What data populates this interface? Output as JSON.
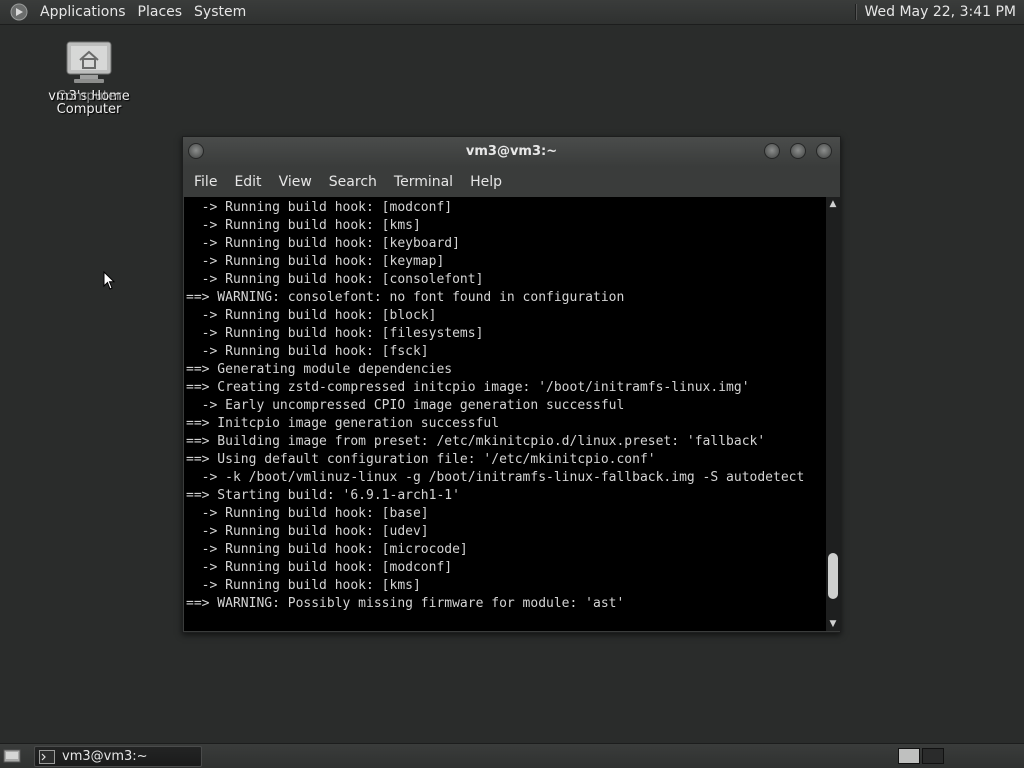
{
  "top_panel": {
    "menu": [
      "Applications",
      "Places",
      "System"
    ],
    "clock": "Wed May 22,  3:41 PM"
  },
  "desktop_icon": {
    "label_overlap_a": "vm3's Home",
    "label_overlap_b": "Computer",
    "label_line2": "Computer"
  },
  "window": {
    "title": "vm3@vm3:~",
    "menu": [
      "File",
      "Edit",
      "View",
      "Search",
      "Terminal",
      "Help"
    ],
    "terminal_lines": [
      "  -> Running build hook: [modconf]",
      "  -> Running build hook: [kms]",
      "  -> Running build hook: [keyboard]",
      "  -> Running build hook: [keymap]",
      "  -> Running build hook: [consolefont]",
      "==> WARNING: consolefont: no font found in configuration",
      "  -> Running build hook: [block]",
      "  -> Running build hook: [filesystems]",
      "  -> Running build hook: [fsck]",
      "==> Generating module dependencies",
      "==> Creating zstd-compressed initcpio image: '/boot/initramfs-linux.img'",
      "  -> Early uncompressed CPIO image generation successful",
      "==> Initcpio image generation successful",
      "==> Building image from preset: /etc/mkinitcpio.d/linux.preset: 'fallback'",
      "==> Using default configuration file: '/etc/mkinitcpio.conf'",
      "  -> -k /boot/vmlinuz-linux -g /boot/initramfs-linux-fallback.img -S autodetect",
      "==> Starting build: '6.9.1-arch1-1'",
      "  -> Running build hook: [base]",
      "  -> Running build hook: [udev]",
      "  -> Running build hook: [microcode]",
      "  -> Running build hook: [modconf]",
      "  -> Running build hook: [kms]",
      "==> WARNING: Possibly missing firmware for module: 'ast'"
    ],
    "scroll_position": 0.95
  },
  "bottom_panel": {
    "task": "vm3@vm3:~"
  }
}
